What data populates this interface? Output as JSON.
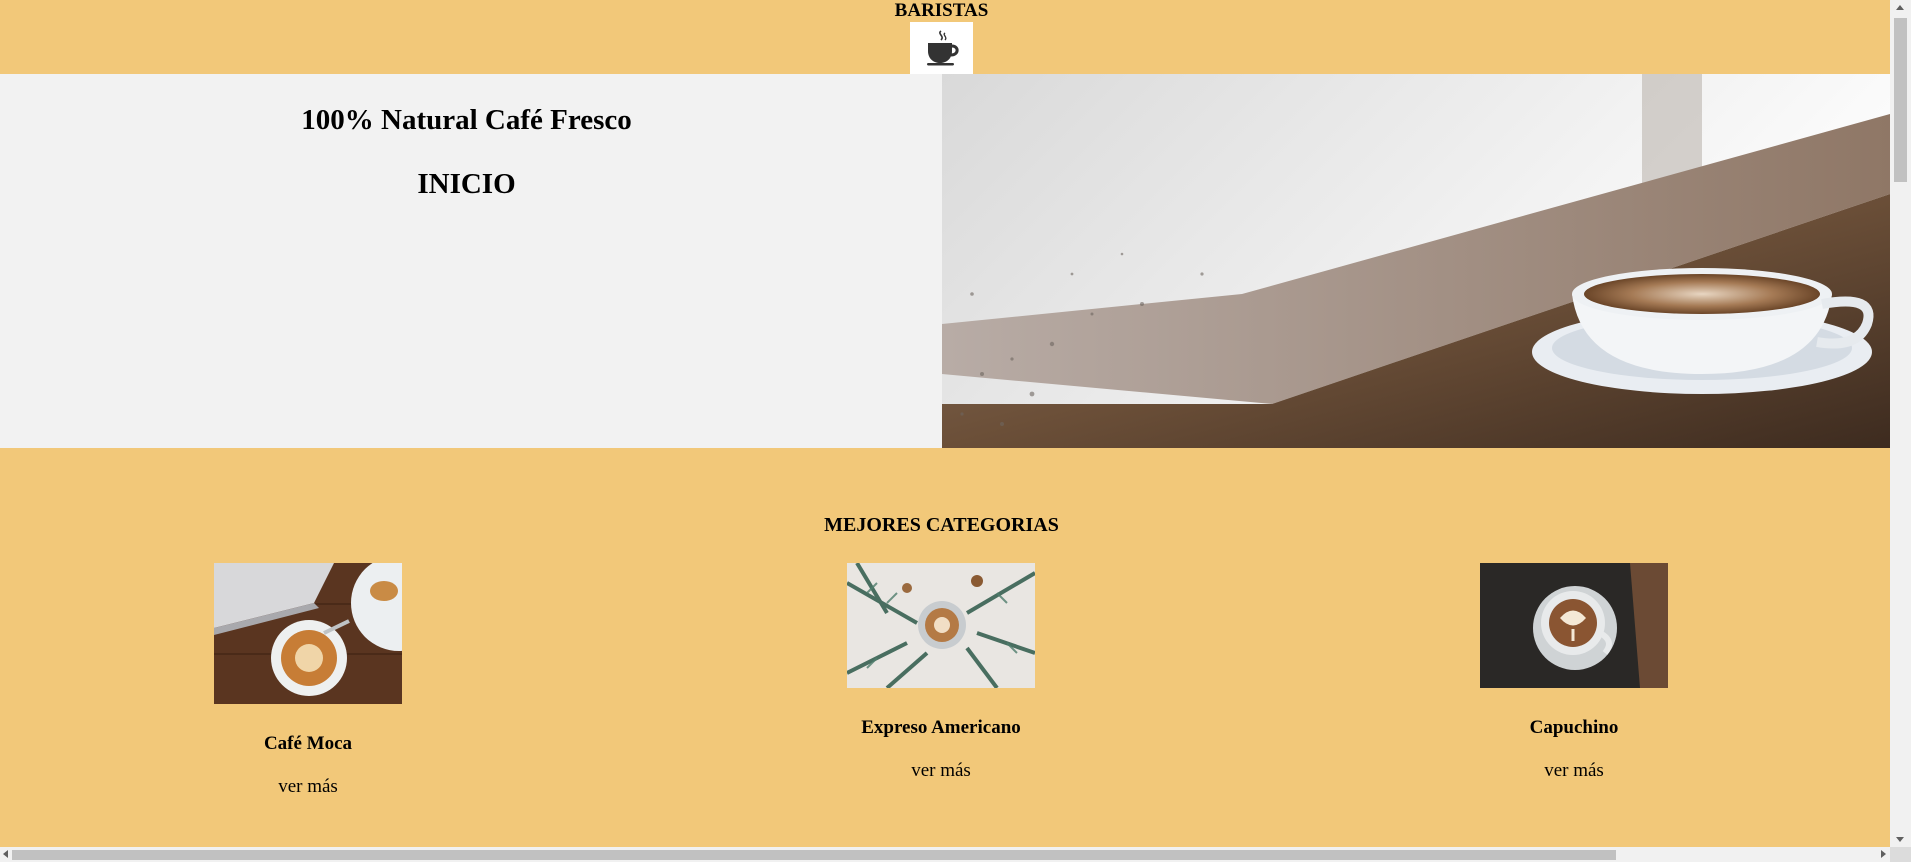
{
  "header": {
    "brand": "BARISTAS",
    "logo_icon": "coffee-cup-icon"
  },
  "hero": {
    "title": "100% Natural Café Fresco",
    "subtitle": "INICIO",
    "image": "latte-cup-on-wooden-table-by-window"
  },
  "categories": {
    "title": "MEJORES CATEGORIAS",
    "items": [
      {
        "name": "Café Moca",
        "link": "ver más",
        "image": "latte-croissant-laptop-top-view"
      },
      {
        "name": "Expreso Americano",
        "link": "ver más",
        "image": "latte-with-pine-branches"
      },
      {
        "name": "Capuchino",
        "link": "ver más",
        "image": "latte-art-cup-on-dark-table"
      }
    ]
  },
  "colors": {
    "header_bg": "#f2c879",
    "hero_bg": "#f2f2f2",
    "text": "#000000"
  }
}
